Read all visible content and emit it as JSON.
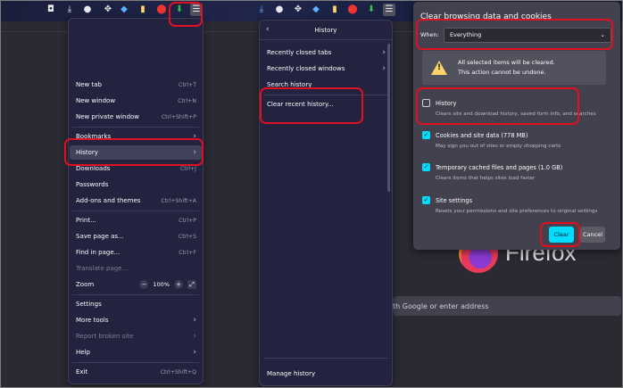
{
  "browser": {
    "toolbar_icons": [
      "pocket-icon",
      "download-icon",
      "media-icon",
      "extensions-icon",
      "blue-icon",
      "addon-icon",
      "red-shield-icon",
      "green-download-icon",
      "hamburger-icon"
    ],
    "search_placeholder": "Search with Google or enter address",
    "search_visible_text": "th Google or enter address",
    "brand_word": "Firefox",
    "brand_visible_text": "Firefox"
  },
  "app_menu": {
    "items": [
      {
        "label": "New tab",
        "shortcut": "Ctrl+T"
      },
      {
        "label": "New window",
        "shortcut": "Ctrl+N"
      },
      {
        "label": "New private window",
        "shortcut": "Ctrl+Shift+P"
      },
      {
        "label": "Bookmarks",
        "shortcut": ""
      },
      {
        "label": "History",
        "shortcut": ""
      },
      {
        "label": "Downloads",
        "shortcut": "Ctrl+J"
      },
      {
        "label": "Passwords",
        "shortcut": ""
      },
      {
        "label": "Add-ons and themes",
        "shortcut": "Ctrl+Shift+A"
      },
      {
        "label": "Print...",
        "shortcut": "Ctrl+P"
      },
      {
        "label": "Save page as...",
        "shortcut": "Ctrl+S"
      },
      {
        "label": "Find in page...",
        "shortcut": "Ctrl+F"
      },
      {
        "label": "Translate page...",
        "shortcut": ""
      },
      {
        "label": "Zoom",
        "shortcut": ""
      },
      {
        "label": "Settings",
        "shortcut": ""
      },
      {
        "label": "More tools",
        "shortcut": ""
      },
      {
        "label": "Report broken site",
        "shortcut": ""
      },
      {
        "label": "Help",
        "shortcut": ""
      },
      {
        "label": "Exit",
        "shortcut": "Ctrl+Shift+Q"
      }
    ],
    "zoom": {
      "minus": "−",
      "value": "100%",
      "plus": "+",
      "fullscreen": "⤢"
    }
  },
  "history_panel": {
    "title": "History",
    "items": [
      {
        "label": "Recently closed tabs"
      },
      {
        "label": "Recently closed windows"
      },
      {
        "label": "Search history"
      },
      {
        "label": "Clear recent history..."
      }
    ],
    "footer": "Manage history"
  },
  "clear_dialog": {
    "title": "Clear browsing data and cookies",
    "when_label": "When:",
    "when_value": "Everything",
    "warning_line1": "All selected items will be cleared.",
    "warning_line2": "This action cannot be undone.",
    "options": [
      {
        "label": "History",
        "desc": "Clears site and download history, saved form info, and searches",
        "checked": false
      },
      {
        "label": "Cookies and site data (778 MB)",
        "desc": "May sign you out of sites or empty shopping carts",
        "checked": true
      },
      {
        "label": "Temporary cached files and pages (1.0 GB)",
        "desc": "Clears items that helps sites load faster",
        "checked": true
      },
      {
        "label": "Site settings",
        "desc": "Resets your permissions and site preferences to original settings",
        "checked": true
      }
    ],
    "clear_label": "Clear",
    "cancel_label": "Cancel"
  },
  "colors": {
    "accent": "#00ddff",
    "highlight": "#e01020",
    "menu_bg": "#23233f"
  }
}
